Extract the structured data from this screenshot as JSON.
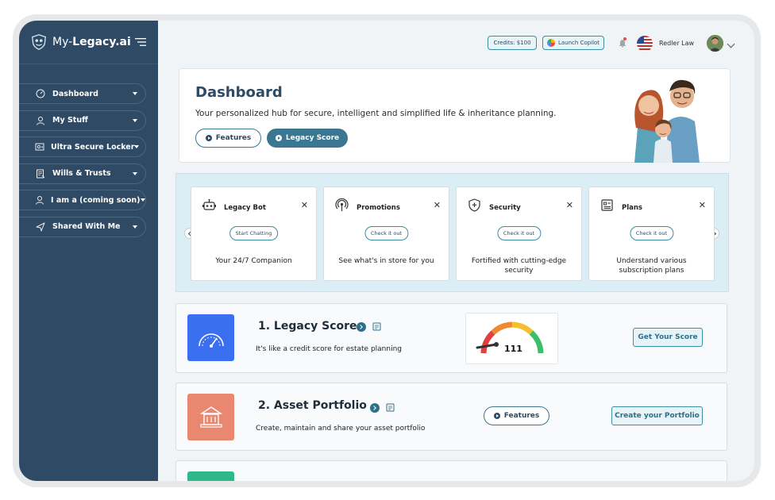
{
  "brand": {
    "prefix": "My-",
    "name": "Legacy.ai",
    "primary": "#2f4a64",
    "accent": "#3b7790"
  },
  "sidebar": {
    "items": [
      {
        "label": "Dashboard",
        "icon": "dashboard-gauge-icon"
      },
      {
        "label": "My Stuff",
        "icon": "user-icon"
      },
      {
        "label": "Ultra Secure Locker",
        "icon": "locker-icon"
      },
      {
        "label": "Wills & Trusts",
        "icon": "document-icon"
      },
      {
        "label": "I am a (coming soon)",
        "icon": "person-icon"
      },
      {
        "label": "Shared With Me",
        "icon": "send-icon"
      }
    ]
  },
  "topbar": {
    "credits": "Credits: $100",
    "copilot": "Launch Copilot",
    "user_name": "Redler Law"
  },
  "hero": {
    "title": "Dashboard",
    "subtitle": "Your personalized hub for secure, intelligent and simplified life & inheritance planning.",
    "features_label": "Features",
    "score_label": "Legacy Score"
  },
  "cards": [
    {
      "title": "Legacy Bot",
      "button": "Start Chatting",
      "desc": "Your 24/7 Companion",
      "icon": "robot-icon"
    },
    {
      "title": "Promotions",
      "button": "Check it out",
      "desc": "See what's in store for you",
      "icon": "broadcast-icon"
    },
    {
      "title": "Security",
      "button": "Check it out",
      "desc": "Fortified with cutting-edge security",
      "icon": "shield-icon"
    },
    {
      "title": "Plans",
      "button": "Check it out",
      "desc": "Understand various subscription plans",
      "icon": "plans-icon"
    }
  ],
  "sections": [
    {
      "title": "1. Legacy Score",
      "desc": "It's like a credit score for estate planning",
      "action": "Get Your Score",
      "gauge_value": "111",
      "icon_color": "#3a6ff0"
    },
    {
      "title": "2. Asset Portfolio",
      "desc": "Create, maintain and share your asset portfolio",
      "action": "Create your Portfolio",
      "features_label": "Features",
      "icon_color": "#ea8770"
    },
    {
      "icon_color": "#2fb88a"
    }
  ]
}
